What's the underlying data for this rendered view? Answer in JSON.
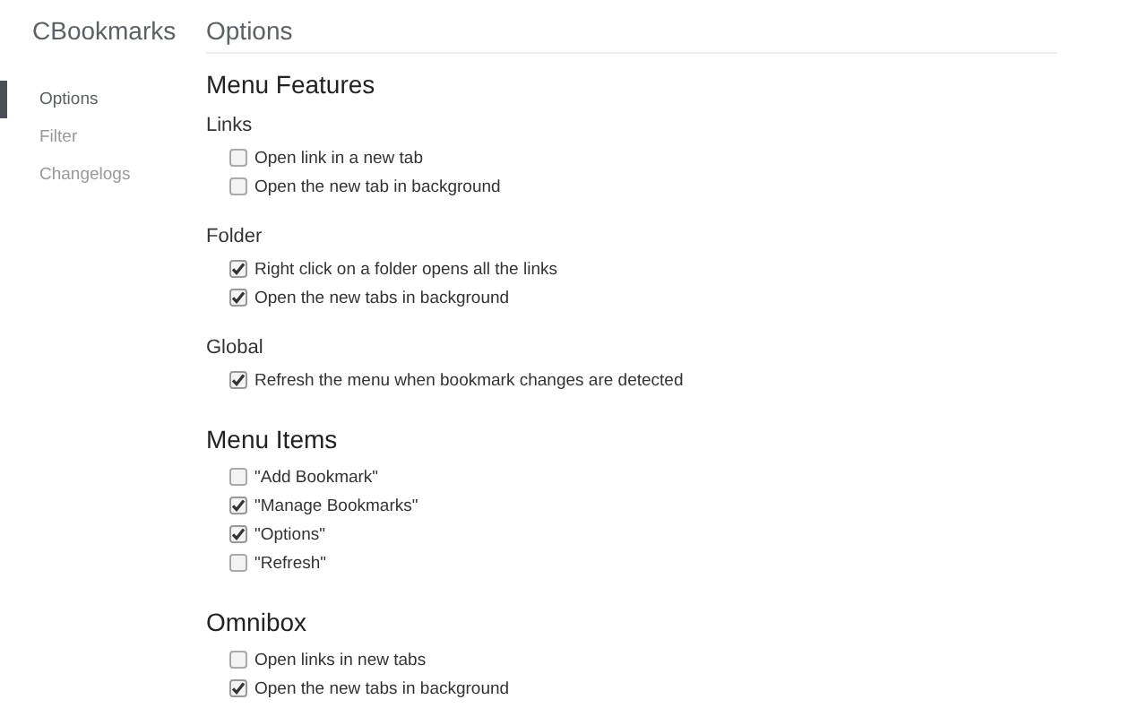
{
  "sidebar": {
    "title": "CBookmarks",
    "items": [
      {
        "label": "Options",
        "selected": true
      },
      {
        "label": "Filter",
        "selected": false
      },
      {
        "label": "Changelogs",
        "selected": false
      }
    ]
  },
  "page_title": "Options",
  "blocks": [
    {
      "kind": "section",
      "title": "Menu Features"
    },
    {
      "kind": "group",
      "title": "Links",
      "options": [
        {
          "label": "Open link in a new tab",
          "checked": false
        },
        {
          "label": "Open the new tab in background",
          "checked": false
        }
      ]
    },
    {
      "kind": "group",
      "title": "Folder",
      "options": [
        {
          "label": "Right click on a folder opens all the links",
          "checked": true
        },
        {
          "label": "Open the new tabs in background",
          "checked": true
        }
      ]
    },
    {
      "kind": "group",
      "title": "Global",
      "options": [
        {
          "label": "Refresh the menu when bookmark changes are detected",
          "checked": true
        }
      ]
    },
    {
      "kind": "section",
      "title": "Menu Items",
      "options": [
        {
          "label": "\"Add Bookmark\"",
          "checked": false
        },
        {
          "label": "\"Manage Bookmarks\"",
          "checked": true
        },
        {
          "label": "\"Options\"",
          "checked": true
        },
        {
          "label": "\"Refresh\"",
          "checked": false
        }
      ]
    },
    {
      "kind": "section",
      "title": "Omnibox",
      "options": [
        {
          "label": "Open links in new tabs",
          "checked": false
        },
        {
          "label": "Open the new tabs in background",
          "checked": true
        }
      ]
    }
  ]
}
